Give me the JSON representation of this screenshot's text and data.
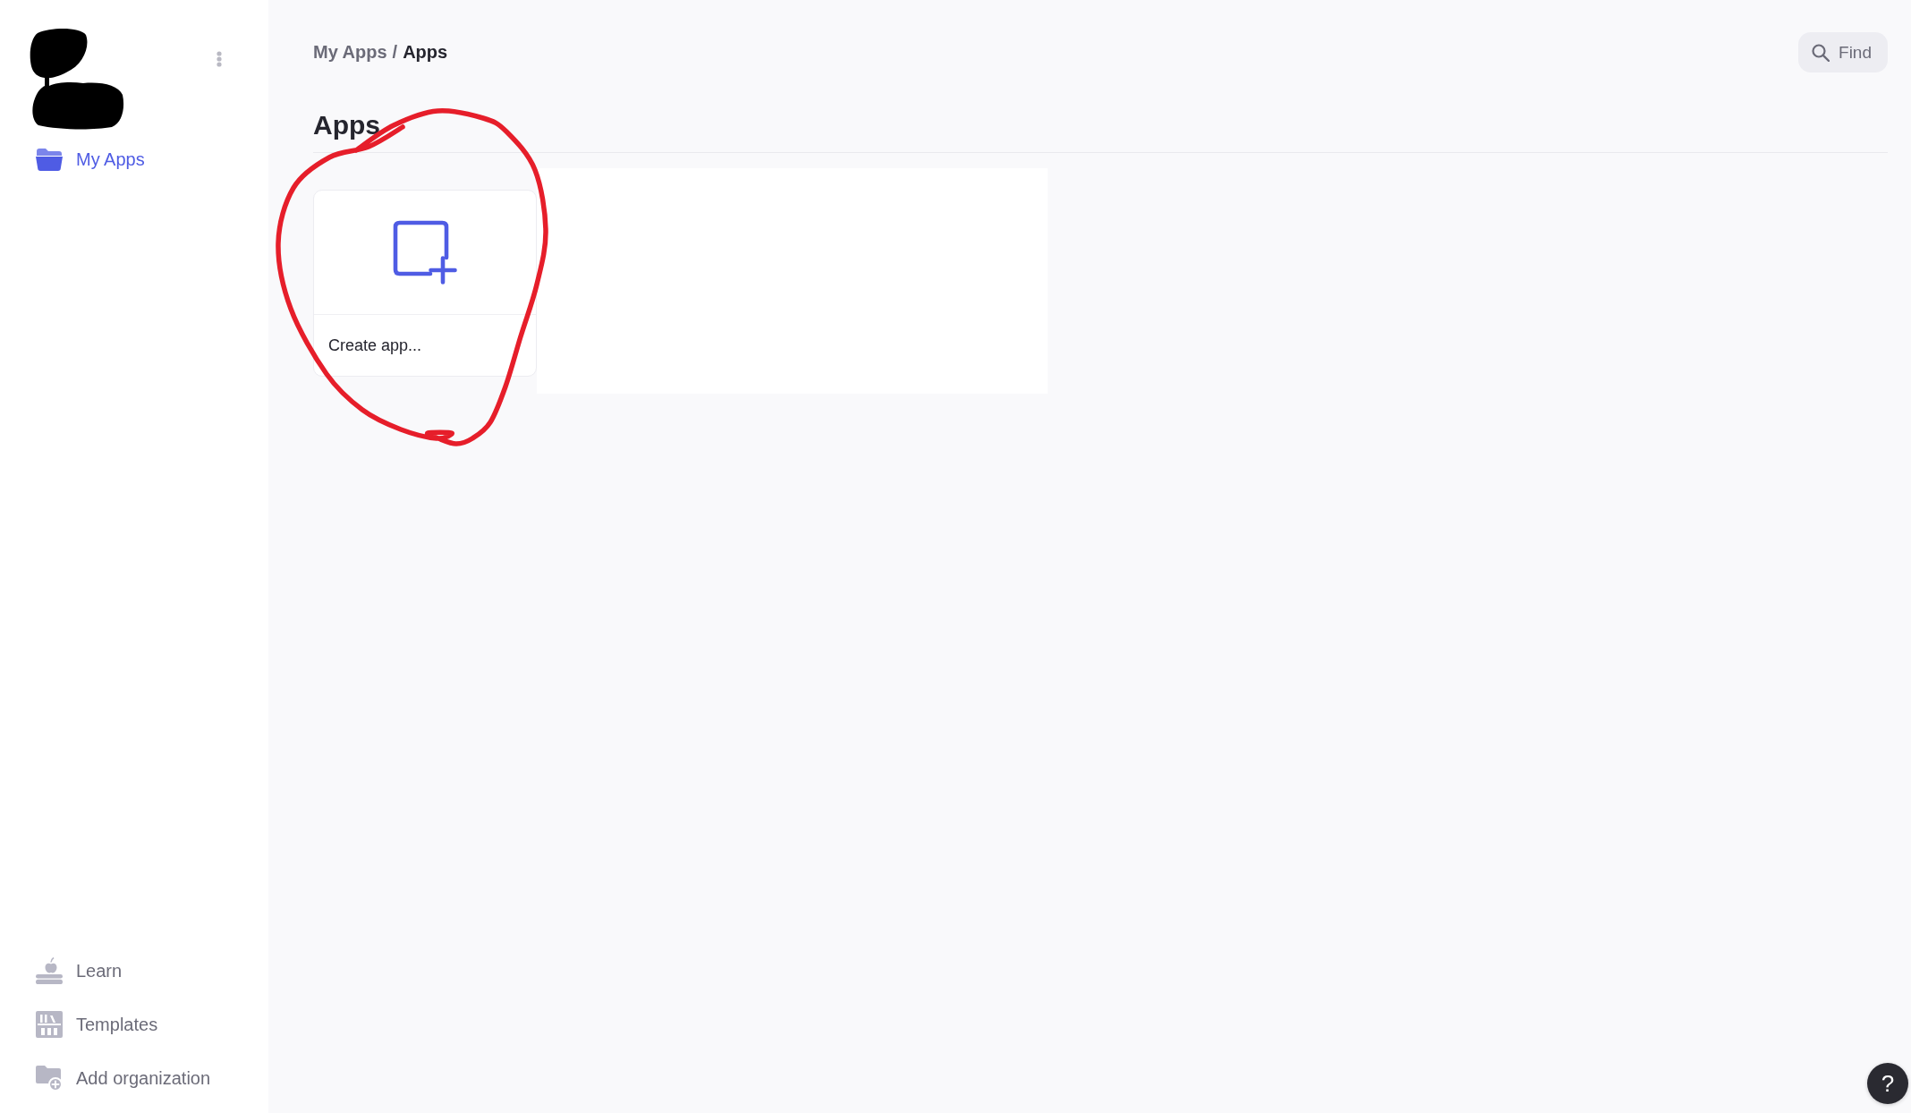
{
  "sidebar": {
    "items": [
      {
        "label": "My Apps",
        "selected": true
      }
    ],
    "footer_items": [
      {
        "label": "Learn",
        "selected": false
      },
      {
        "label": "Templates",
        "selected": false
      },
      {
        "label": "Add organization",
        "selected": false
      }
    ]
  },
  "breadcrumb": {
    "items": [
      {
        "label": "My Apps",
        "current": false
      },
      {
        "label": "Apps",
        "current": true
      }
    ],
    "separator": "/"
  },
  "search_button": {
    "label": "Find"
  },
  "page_title": "Apps",
  "create_card": {
    "label": "Create app..."
  },
  "help_button": {
    "label": "?"
  }
}
